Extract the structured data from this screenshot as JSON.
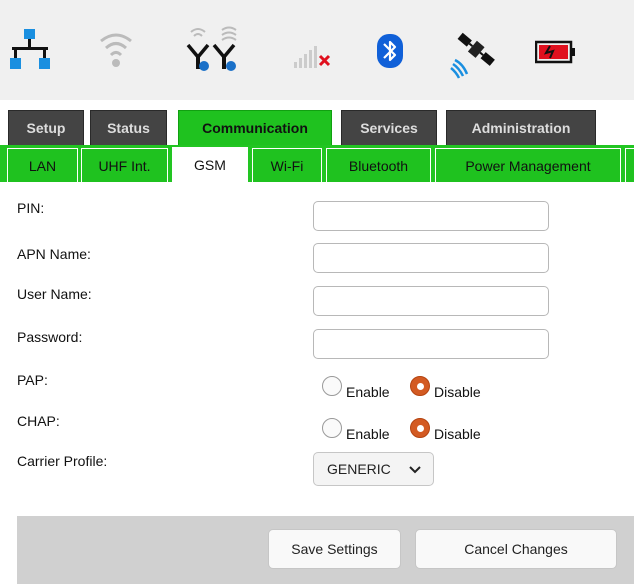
{
  "status_icons": [
    "network-icon",
    "wifi-icon",
    "uhf-antenna-icon",
    "cell-signal-icon",
    "bluetooth-icon",
    "satellite-icon",
    "battery-icon"
  ],
  "main_tabs": [
    {
      "label": "Setup",
      "active": false
    },
    {
      "label": "Status",
      "active": false
    },
    {
      "label": "Communication",
      "active": true
    },
    {
      "label": "Services",
      "active": false
    },
    {
      "label": "Administration",
      "active": false
    }
  ],
  "sub_tabs": [
    {
      "label": "LAN",
      "active": false
    },
    {
      "label": "UHF Int.",
      "active": false
    },
    {
      "label": "GSM",
      "active": true
    },
    {
      "label": "Wi-Fi",
      "active": false
    },
    {
      "label": "Bluetooth",
      "active": false
    },
    {
      "label": "Power Management",
      "active": false
    }
  ],
  "form": {
    "pin": {
      "label": "PIN:",
      "value": ""
    },
    "apn": {
      "label": "APN Name:",
      "value": ""
    },
    "user": {
      "label": "User Name:",
      "value": ""
    },
    "password": {
      "label": "Password:",
      "value": ""
    },
    "pap": {
      "label": "PAP:",
      "enable": "Enable",
      "disable": "Disable",
      "selected": "Disable"
    },
    "chap": {
      "label": "CHAP:",
      "enable": "Enable",
      "disable": "Disable",
      "selected": "Disable"
    },
    "carrier": {
      "label": "Carrier Profile:",
      "value": "GENERIC"
    }
  },
  "buttons": {
    "save": "Save Settings",
    "cancel": "Cancel Changes"
  },
  "colors": {
    "accent_green": "#1fc21f",
    "tab_dark": "#444444",
    "radio_selected": "#d35a22",
    "battery_red": "#e0101e",
    "bluetooth_blue": "#1060d8",
    "network_blue": "#1a8fe0"
  }
}
